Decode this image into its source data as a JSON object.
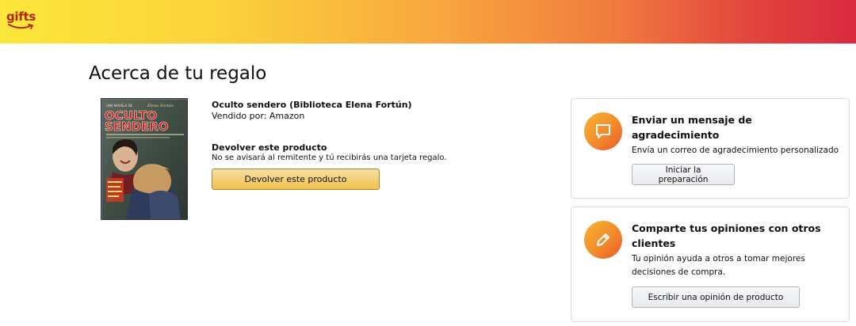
{
  "header": {
    "logo_text": "gifts",
    "logo_icon": "amazon-smile-icon",
    "gradient_colors": [
      "#fde73a",
      "#f9a93f",
      "#d92a40"
    ]
  },
  "page": {
    "title": "Acerca de tu regalo"
  },
  "product": {
    "cover_icon": "book-cover-image",
    "cover_lines": [
      "UNA NOVELA DE",
      "Elena Fortún",
      "OCULTO",
      "SENDERO"
    ],
    "title": "Oculto sendero (Biblioteca Elena Fortún)",
    "sold_by": "Vendido por: Amazon",
    "return_heading": "Devolver este producto",
    "return_note": "No se avisará al remitente y tú recibirás una tarjeta regalo.",
    "return_button": "Devolver este producto",
    "return_button_color": "#f0c14b"
  },
  "cards": [
    {
      "icon": "chat-bubble-icon",
      "title": "Enviar un mensaje de agradecimiento",
      "description": "Envía un correo de agradecimiento personalizado",
      "button": "Iniciar la preparación"
    },
    {
      "icon": "pencil-icon",
      "title": "Comparte tus opiniones con otros clientes",
      "description": "Tu opinión ayuda a otros a tomar mejores decisiones de compra.",
      "button": "Escribir una opinión de producto"
    }
  ],
  "accent_color": "#f28a2c"
}
